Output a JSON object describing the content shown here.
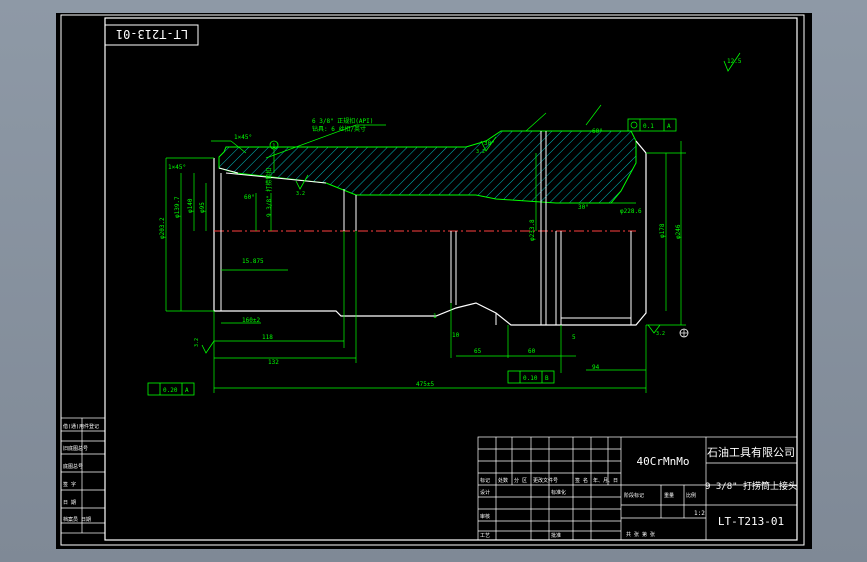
{
  "drawing": {
    "code_top": "LT-T213-01",
    "material": "40CrMnMo",
    "company": "石油工具有限公司",
    "part_name": "9 3/8\" 打捞筒上接头",
    "drawing_no": "LT-T213-01",
    "scale": "1:2",
    "roughness_general": "12.5"
  },
  "title_block": {
    "h_mark": "标记",
    "h_count": "处数",
    "h_zone": "分 区",
    "h_change": "更改文件号",
    "h_sign": "签 名",
    "h_date": "年、月、日",
    "h_design": "设计",
    "h_std": "标准化",
    "h_stage": "阶段标记",
    "h_weight": "重量",
    "h_ratio": "比例",
    "h_review": "审核",
    "h_process": "工艺",
    "h_approve": "批准",
    "h_sheets": "共 张 第 张"
  },
  "side_block": {
    "r1": "借(通)用件登记",
    "r2": "旧底图总号",
    "r3": "底图总号",
    "r4": "签 字",
    "r5": "日 期",
    "r6": "档案员 日期"
  },
  "annotations": {
    "chamfer_1": "1×45°",
    "chamfer_2": "1×45°",
    "thread_left": "6 3/8\" 正规扣(API)",
    "thread_left_2": "钻具: 6 丝扣/英寸",
    "thread_right": "9 3/8\" 打捞筒扣",
    "label_15": "15.875",
    "len_1": "160±2",
    "len_2": "118",
    "len_3": "132",
    "len_total": "475±5",
    "len_65": "65",
    "len_60": "60",
    "len_5": "5",
    "len_10": "10",
    "len_94": "94",
    "len_1b": "1",
    "dia_1": "φ203.2",
    "dia_2": "φ139.7",
    "dia_3": "φ140",
    "dia_4": "φ95",
    "dia_5": "φ233.8",
    "dia_6": "φ178",
    "dia_7": "φ246",
    "dia_8": "φ228.6",
    "angle_1": "60°",
    "angle_2": "30°",
    "angle_3": "30°",
    "angle_4": "60°",
    "tol_1": "0.20",
    "tol_2": "0.10",
    "tol_3": "0.1",
    "datum_a": "A",
    "datum_b": "B",
    "ra_1": "3.2",
    "ra_2": "3.2",
    "ra_3": "3.2",
    "ra_4": "3.2",
    "circle_1": "1"
  }
}
